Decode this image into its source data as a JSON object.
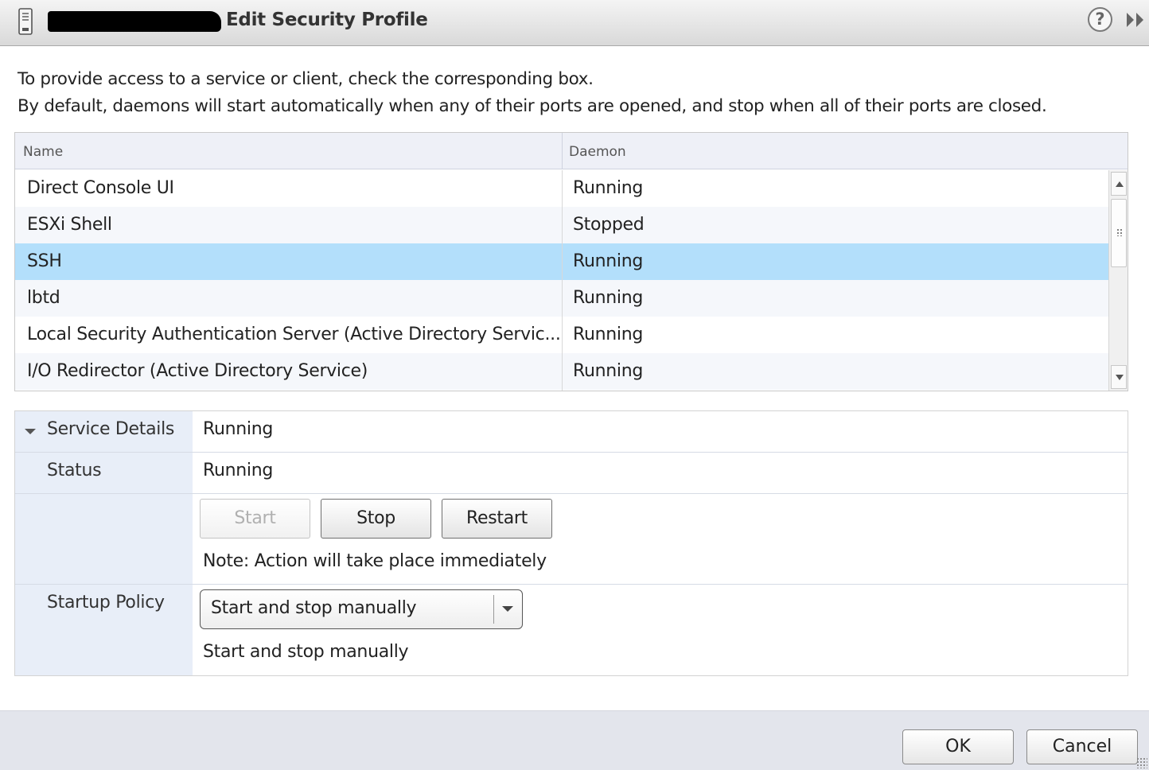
{
  "window": {
    "title": "Edit Security Profile",
    "help_label": "?"
  },
  "intro": {
    "line1": "To provide access to a service or client, check the corresponding box.",
    "line2": "By default, daemons will start automatically when any of their ports are opened, and stop when all of their ports are closed."
  },
  "table": {
    "columns": [
      "Name",
      "Daemon"
    ],
    "rows": [
      {
        "name": "Direct Console UI",
        "daemon": "Running",
        "selected": false
      },
      {
        "name": "ESXi Shell",
        "daemon": "Stopped",
        "selected": false
      },
      {
        "name": "SSH",
        "daemon": "Running",
        "selected": true
      },
      {
        "name": "lbtd",
        "daemon": "Running",
        "selected": false
      },
      {
        "name": "Local Security Authentication Server (Active Directory Servic...",
        "daemon": "Running",
        "selected": false
      },
      {
        "name": "I/O Redirector (Active Directory Service)",
        "daemon": "Running",
        "selected": false
      }
    ],
    "row_colors": {
      "odd": "#ffffff",
      "even": "#f5f7fb",
      "selected": "#b3dffb"
    }
  },
  "details": {
    "section_label": "Service Details",
    "section_value": "Running",
    "status_label": "Status",
    "status_value": "Running",
    "buttons": {
      "start": "Start",
      "stop": "Stop",
      "restart": "Restart"
    },
    "note": "Note: Action will take place immediately",
    "startup_label": "Startup Policy",
    "startup_selected": "Start and stop manually",
    "startup_description": "Start and stop manually"
  },
  "footer": {
    "ok_label": "OK",
    "cancel_label": "Cancel"
  },
  "icons": {
    "host": "host-icon",
    "help": "help-icon",
    "expand": "double-chevron-right-icon",
    "scroll_up": "scroll-up-icon",
    "scroll_down": "scroll-down-icon",
    "section_caret": "caret-down-icon",
    "dropdown": "chevron-down-icon"
  }
}
